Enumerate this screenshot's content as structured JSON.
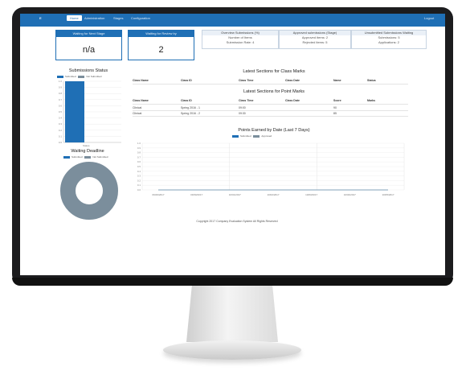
{
  "nav": {
    "brand": "E",
    "items": [
      "Home",
      "Administration",
      "Stages",
      "Configuration"
    ],
    "user": "Logout"
  },
  "stats": {
    "waiting_stage_label": "Waiting for Next Stage",
    "waiting_stage_value": "n/a",
    "waiting_review_label": "Waiting for Review by",
    "waiting_review_value": "2"
  },
  "mini_cards": [
    {
      "title": "Overview Submissions (%)",
      "line1": "Number of Items",
      "line2": "Submission Rate: 4"
    },
    {
      "title": "Approved submissions (Stage)",
      "line1": "Approved items: 2",
      "line2": "Rejected items: 5"
    },
    {
      "title": "Unsubmitted Submissions Waiting",
      "line1": "Submissions: 5",
      "line2": "Applications: 2"
    }
  ],
  "left_bar": {
    "title": "Submissions Status",
    "legend": [
      "Submitted",
      "Not Submitted"
    ],
    "category": "Status"
  },
  "left_donut": {
    "title": "Waiting Deadline",
    "legend": [
      "Submitted",
      "Not Submitted"
    ]
  },
  "table1": {
    "title": "Latest Sections for Class Marks",
    "headers": [
      "Class Name",
      "Class ID",
      "Class Time",
      "Class Date",
      "Name",
      "Status"
    ]
  },
  "table2": {
    "title": "Latest Sections for Point Marks",
    "headers": [
      "Class Name",
      "Class ID",
      "Class Time",
      "Class Date",
      "Score",
      "Marks"
    ],
    "rows": [
      [
        "Clinical",
        "Spring 2016 - 1",
        "09:00",
        "",
        "90",
        ""
      ],
      [
        "Clinical",
        "Spring 2016 - 2",
        "09:30",
        "",
        "85",
        ""
      ]
    ]
  },
  "line_chart": {
    "title": "Points Earned by Date (Last 7 Days)",
    "legend": [
      "Submitted",
      "Approved"
    ],
    "x_labels": [
      "09/29/2017",
      "09/30/2017",
      "10/01/2017",
      "10/02/2017",
      "10/03/2017",
      "10/04/2017",
      "10/05/2017"
    ]
  },
  "footer": "Copyright 2017 Company Evaluation System All Rights Reserved",
  "colors": {
    "primary": "#1f6fb5",
    "secondary": "#7b8e9c"
  },
  "chart_data": [
    {
      "type": "bar",
      "title": "Submissions Status",
      "categories": [
        "Status"
      ],
      "series": [
        {
          "name": "Submitted",
          "values": [
            1
          ]
        },
        {
          "name": "Not Submitted",
          "values": [
            0
          ]
        }
      ],
      "ylim": [
        0,
        1
      ]
    },
    {
      "type": "pie",
      "title": "Waiting Deadline",
      "labels": [
        "Submitted",
        "Not Submitted"
      ],
      "values": [
        0,
        100
      ]
    },
    {
      "type": "line",
      "title": "Points Earned by Date (Last 7 Days)",
      "x": [
        "09/29/2017",
        "09/30/2017",
        "10/01/2017",
        "10/02/2017",
        "10/03/2017",
        "10/04/2017",
        "10/05/2017"
      ],
      "series": [
        {
          "name": "Submitted",
          "values": [
            0,
            0,
            0,
            0,
            0,
            0,
            0
          ]
        },
        {
          "name": "Approved",
          "values": [
            0,
            0,
            0,
            0,
            0,
            0,
            0
          ]
        }
      ],
      "ylim": [
        0,
        1
      ]
    }
  ]
}
